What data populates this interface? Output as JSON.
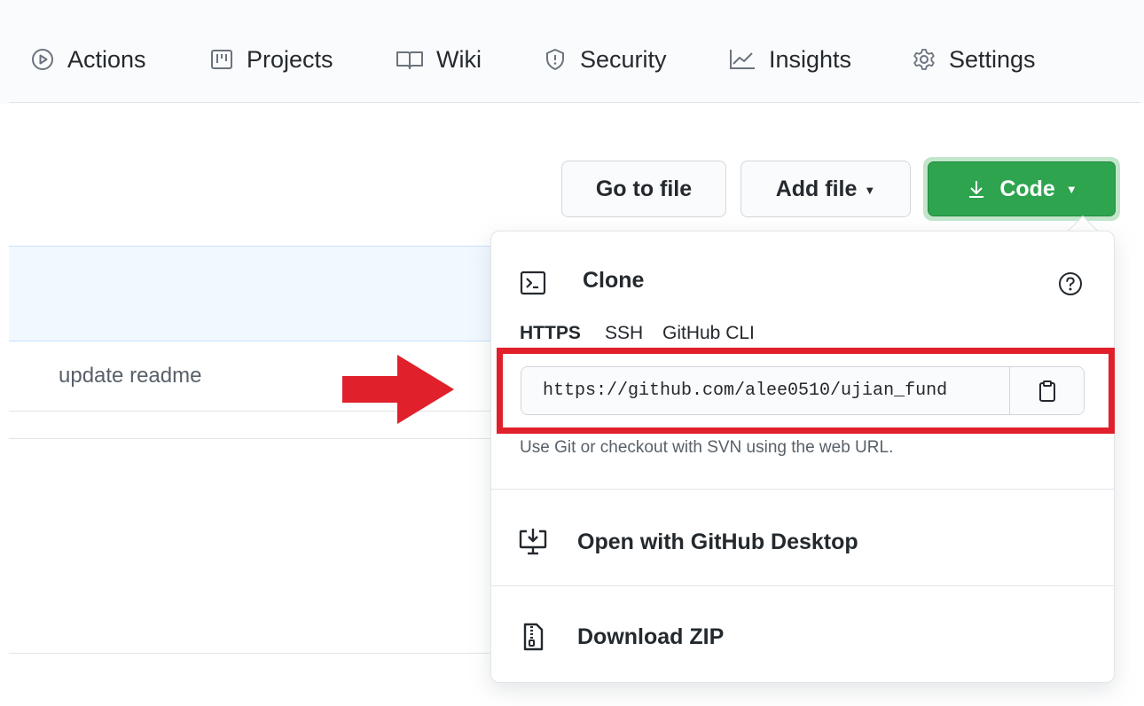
{
  "repo_nav": {
    "items": [
      {
        "label": "Actions",
        "icon": "play-circle-icon"
      },
      {
        "label": "Projects",
        "icon": "project-board-icon"
      },
      {
        "label": "Wiki",
        "icon": "book-icon"
      },
      {
        "label": "Security",
        "icon": "shield-icon"
      },
      {
        "label": "Insights",
        "icon": "graph-icon"
      },
      {
        "label": "Settings",
        "icon": "gear-icon"
      }
    ]
  },
  "toolbar": {
    "go_to_file_label": "Go to file",
    "add_file_label": "Add file",
    "code_label": "Code"
  },
  "file_list": {
    "commit_message": "update readme"
  },
  "clone_menu": {
    "title": "Clone",
    "tabs": [
      {
        "label": "HTTPS",
        "active": true
      },
      {
        "label": "SSH",
        "active": false
      },
      {
        "label": "GitHub CLI",
        "active": false
      }
    ],
    "url_value": "https://github.com/alee0510/ujian_fund",
    "hint": "Use Git or checkout with SVN using the web URL.",
    "open_desktop_label": "Open with GitHub Desktop",
    "download_zip_label": "Download ZIP"
  },
  "colors": {
    "code_button": "#2ea44f",
    "highlight": "#e0202a",
    "text": "#24292e",
    "muted": "#586069"
  }
}
